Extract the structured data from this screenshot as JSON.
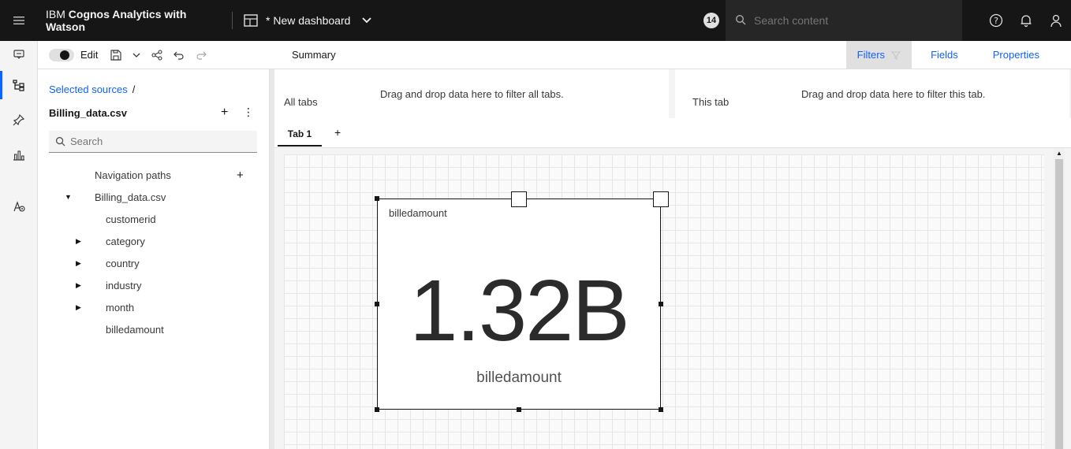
{
  "topbar": {
    "brand_prefix": "IBM ",
    "brand_bold": "Cognos Analytics with Watson",
    "dashboard_title": "* New dashboard",
    "notification_count": "14",
    "search_placeholder": "Search content"
  },
  "toolbar": {
    "edit_label": "Edit",
    "summary_label": "Summary",
    "filters_label": "Filters",
    "fields_label": "Fields",
    "properties_label": "Properties"
  },
  "sources": {
    "breadcrumb": "Selected sources",
    "breadcrumb_sep": "/",
    "title": "Billing_data.csv",
    "search_placeholder": "Search",
    "tree": [
      {
        "label": "Navigation paths"
      },
      {
        "label": "Billing_data.csv"
      },
      {
        "label": "customerid"
      },
      {
        "label": "category"
      },
      {
        "label": "country"
      },
      {
        "label": "industry"
      },
      {
        "label": "month"
      },
      {
        "label": "billedamount"
      }
    ]
  },
  "filters": {
    "all_tabs_label": "All tabs",
    "all_tabs_hint": "Drag and drop data here to filter all tabs.",
    "this_tab_label": "This tab",
    "this_tab_hint": "Drag and drop data here to filter this tab."
  },
  "tabs": {
    "tab1_label": "Tab 1",
    "add_label": "+"
  },
  "widget": {
    "title": "billedamount",
    "value": "1.32B",
    "caption": "billedamount"
  }
}
